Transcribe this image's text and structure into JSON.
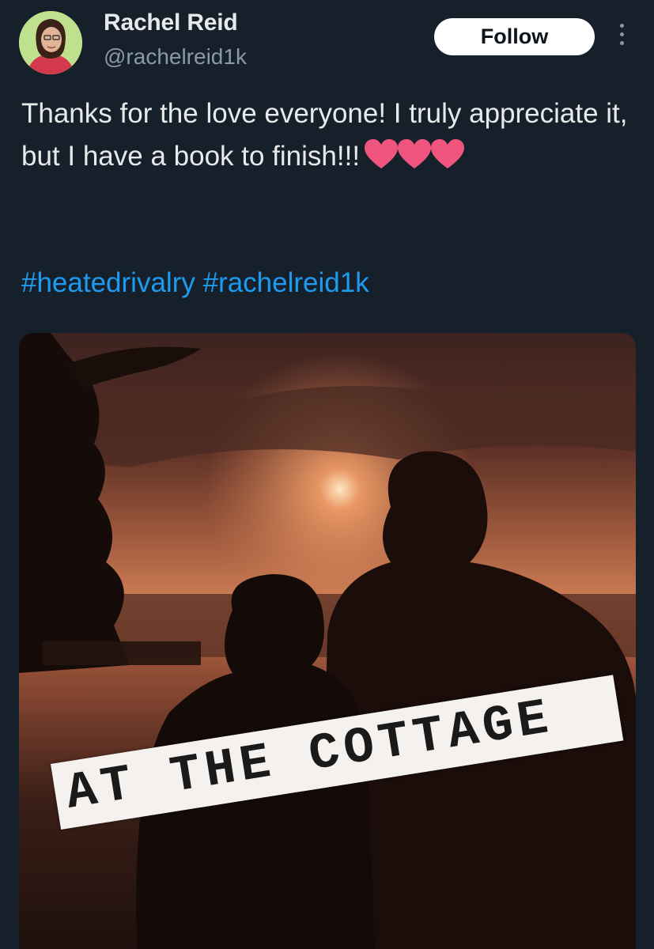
{
  "author": {
    "name": "Rachel Reid",
    "handle": "@rachelreid1k",
    "avatar_icon": "avatar-photo"
  },
  "actions": {
    "follow_label": "Follow",
    "more_icon": "more-options-icon"
  },
  "tweet": {
    "text": "Thanks for the love everyone! I truly appreciate it, but I have a book to finish!!!",
    "emoji": [
      "heart",
      "heart",
      "heart"
    ],
    "hashtags": [
      "#heatedrivalry",
      "#rachelreid1k"
    ]
  },
  "media": {
    "caption": "AT THE COTTAGE"
  },
  "colors": {
    "background": "#15202b",
    "text": "#e7e9ea",
    "secondary": "#8b98a5",
    "link": "#1d9bf0",
    "heart": "#f0557f"
  }
}
